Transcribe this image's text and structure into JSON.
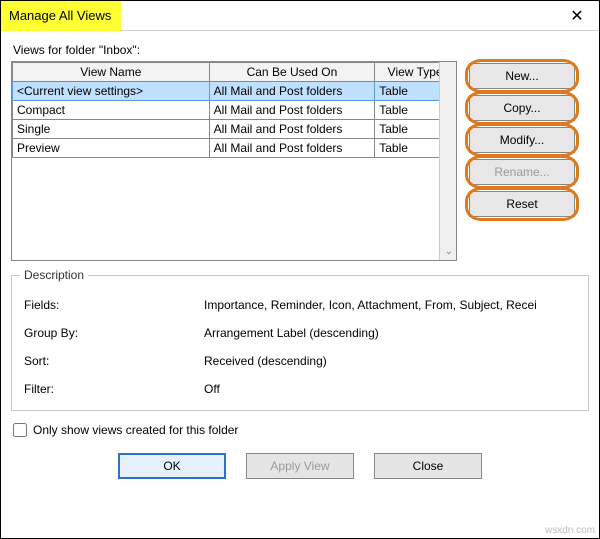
{
  "titlebar": {
    "title": "Manage All Views",
    "close_glyph": "✕"
  },
  "folder_label": "Views for folder \"Inbox\":",
  "table": {
    "headers": {
      "name": "View Name",
      "used": "Can Be Used On",
      "type": "View Type"
    },
    "rows": [
      {
        "name": "<Current view settings>",
        "used": "All Mail and Post folders",
        "type": "Table",
        "selected": true
      },
      {
        "name": "Compact",
        "used": "All Mail and Post folders",
        "type": "Table",
        "selected": false
      },
      {
        "name": "Single",
        "used": "All Mail and Post folders",
        "type": "Table",
        "selected": false
      },
      {
        "name": "Preview",
        "used": "All Mail and Post folders",
        "type": "Table",
        "selected": false
      }
    ]
  },
  "side_buttons": {
    "new": "New...",
    "copy": "Copy...",
    "modify": "Modify...",
    "rename": "Rename...",
    "reset": "Reset"
  },
  "description": {
    "legend": "Description",
    "fields_k": "Fields:",
    "fields_v": "Importance, Reminder, Icon, Attachment, From, Subject, Recei",
    "group_k": "Group By:",
    "group_v": "Arrangement Label (descending)",
    "sort_k": "Sort:",
    "sort_v": "Received (descending)",
    "filter_k": "Filter:",
    "filter_v": "Off"
  },
  "checkbox_label": "Only show views created for this folder",
  "bottom": {
    "ok": "OK",
    "apply": "Apply View",
    "close": "Close"
  },
  "watermark": "wsxdn.com"
}
